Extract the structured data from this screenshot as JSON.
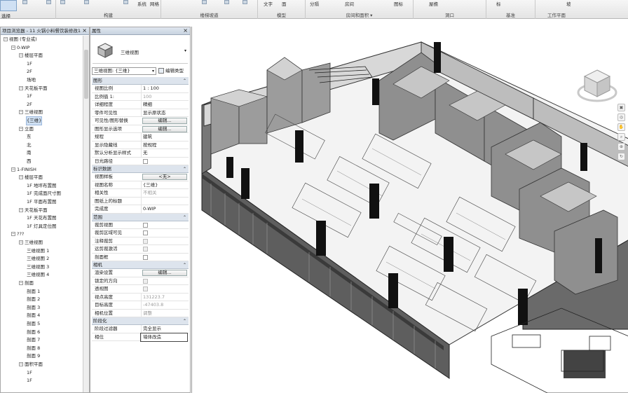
{
  "ribbon": {
    "tab_first": "选择",
    "groups": [
      "构建",
      "楼梯坡道",
      "模型",
      "房间和面积",
      "洞口",
      "基准",
      "工作平面"
    ],
    "room_area_menu_caret": "▾",
    "buttons": [
      "文字",
      "面",
      "系统",
      "网格",
      "分隔",
      "房间",
      "图标",
      "屋檐",
      "标",
      "坡"
    ]
  },
  "project_browser": {
    "title": "项目浏览器 - 11 火锅小料餐饮装修改1",
    "items": [
      {
        "label": "视图 (专业或)",
        "level": 0,
        "toggle": "-"
      },
      {
        "label": "0-WIP",
        "level": 1,
        "toggle": "-"
      },
      {
        "label": "楼层平面",
        "level": 2,
        "toggle": "-"
      },
      {
        "label": "1F",
        "level": 3
      },
      {
        "label": "2F",
        "level": 3
      },
      {
        "label": "场地",
        "level": 3
      },
      {
        "label": "天花板平面",
        "level": 2,
        "toggle": "-"
      },
      {
        "label": "1F",
        "level": 3
      },
      {
        "label": "2F",
        "level": 3
      },
      {
        "label": "三维视图",
        "level": 2,
        "toggle": "-"
      },
      {
        "label": "{三维}",
        "level": 3,
        "selected": true
      },
      {
        "label": "立面",
        "level": 2,
        "toggle": "-"
      },
      {
        "label": "东",
        "level": 3
      },
      {
        "label": "北",
        "level": 3
      },
      {
        "label": "南",
        "level": 3
      },
      {
        "label": "西",
        "level": 3
      },
      {
        "label": "1-FINISH",
        "level": 1,
        "toggle": "-"
      },
      {
        "label": "楼层平面",
        "level": 2,
        "toggle": "-"
      },
      {
        "label": "1F 地坪布置图",
        "level": 3
      },
      {
        "label": "1F 完成面尺寸图",
        "level": 3
      },
      {
        "label": "1F 平面布置图",
        "level": 3
      },
      {
        "label": "天花板平面",
        "level": 2,
        "toggle": "-"
      },
      {
        "label": "1F 天花布置图",
        "level": 3
      },
      {
        "label": "1F 灯具定位图",
        "level": 3
      },
      {
        "label": "???",
        "level": 1,
        "toggle": "-"
      },
      {
        "label": "三维视图",
        "level": 2,
        "toggle": "-"
      },
      {
        "label": "三维视图 1",
        "level": 3
      },
      {
        "label": "三维视图 2",
        "level": 3
      },
      {
        "label": "三维视图 3",
        "level": 3
      },
      {
        "label": "三维视图 4",
        "level": 3
      },
      {
        "label": "剖面",
        "level": 2,
        "toggle": "-"
      },
      {
        "label": "剖面 1",
        "level": 3
      },
      {
        "label": "剖面 2",
        "level": 3
      },
      {
        "label": "剖面 3",
        "level": 3
      },
      {
        "label": "剖面 4",
        "level": 3
      },
      {
        "label": "剖面 5",
        "level": 3
      },
      {
        "label": "剖面 6",
        "level": 3
      },
      {
        "label": "剖面 7",
        "level": 3
      },
      {
        "label": "剖面 8",
        "level": 3
      },
      {
        "label": "剖面 9",
        "level": 3
      },
      {
        "label": "面积平面",
        "level": 2,
        "toggle": "-"
      },
      {
        "label": "1F",
        "level": 3
      },
      {
        "label": "1F",
        "level": 3
      }
    ]
  },
  "properties": {
    "title": "属性",
    "type_name": "三维视图",
    "selector": "三维视图: {三维}",
    "edit_type": "编辑类型",
    "groups": [
      {
        "name": "图形",
        "rows": [
          {
            "k": "视图比例",
            "v": "1 : 100"
          },
          {
            "k": "比例值 1:",
            "v": "100",
            "gray": true
          },
          {
            "k": "详细程度",
            "v": "精细"
          },
          {
            "k": "零件可见性",
            "v": "显示原状态"
          },
          {
            "k": "可见性/图形替换",
            "btn": "编辑..."
          },
          {
            "k": "图形显示选项",
            "btn": "编辑..."
          },
          {
            "k": "规程",
            "v": "建筑"
          },
          {
            "k": "显示隐藏线",
            "v": "按规程"
          },
          {
            "k": "默认分析显示样式",
            "v": "无"
          },
          {
            "k": "日光路径",
            "chk": true
          }
        ]
      },
      {
        "name": "标识数据",
        "rows": [
          {
            "k": "视图样板",
            "btn": "<无>"
          },
          {
            "k": "视图名称",
            "v": "{三维}"
          },
          {
            "k": "相关性",
            "v": "不相关",
            "gray": true
          },
          {
            "k": "图纸上的标题",
            "v": ""
          },
          {
            "k": "完成度",
            "v": "0-WIP"
          }
        ]
      },
      {
        "name": "范围",
        "rows": [
          {
            "k": "裁剪视图",
            "chk": true
          },
          {
            "k": "裁剪区域可见",
            "chk": true
          },
          {
            "k": "注释裁剪",
            "chk": true,
            "dis": true
          },
          {
            "k": "远剪裁激活",
            "chk": true,
            "dis": true
          },
          {
            "k": "剖面框",
            "chk": true
          }
        ]
      },
      {
        "name": "相机",
        "rows": [
          {
            "k": "渲染设置",
            "btn": "编辑..."
          },
          {
            "k": "锁定的方向",
            "chk": true,
            "dis": true
          },
          {
            "k": "透视图",
            "chk": true,
            "dis": true
          },
          {
            "k": "视点高度",
            "v": "131223.7",
            "gray": true
          },
          {
            "k": "目标高度",
            "v": "-47403.8",
            "gray": true
          },
          {
            "k": "相机位置",
            "v": "调整",
            "gray": true
          }
        ]
      },
      {
        "name": "阶段化",
        "rows": [
          {
            "k": "阶段过滤器",
            "v": "完全显示"
          },
          {
            "k": "相位",
            "v": "墙体改造",
            "active": true
          }
        ]
      }
    ]
  },
  "viewcube": {
    "icon": "viewcube-icon"
  },
  "navbar": {
    "buttons": [
      "▣",
      "◎",
      "✋",
      "⌕",
      "⊕",
      "↻"
    ]
  }
}
